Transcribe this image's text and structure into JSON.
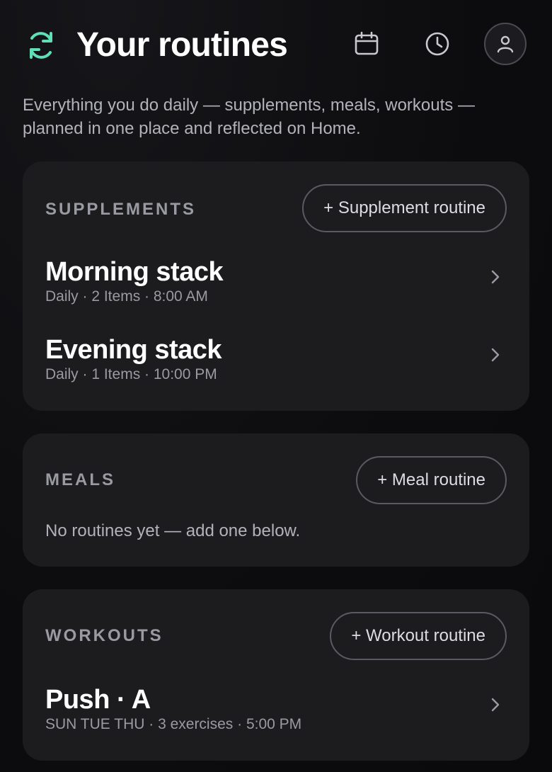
{
  "header": {
    "title": "Your routines",
    "logo_icon": "sync-icon",
    "calendar_icon": "calendar-icon",
    "history_icon": "clock-icon",
    "profile_icon": "user-icon",
    "accent_color": "#5ee0b4"
  },
  "subtitle": "Everything you do daily — supplements, meals, workouts — planned in one place and reflected on Home.",
  "sections": {
    "supplements": {
      "label": "SUPPLEMENTS",
      "add_label": "+ Supplement routine",
      "routines": [
        {
          "title": "Morning stack",
          "meta": "Daily · 2 Items · 8:00 AM"
        },
        {
          "title": "Evening stack",
          "meta": "Daily · 1 Items · 10:00 PM"
        }
      ]
    },
    "meals": {
      "label": "MEALS",
      "add_label": "+ Meal routine",
      "empty_text": "No routines yet — add one below."
    },
    "workouts": {
      "label": "WORKOUTS",
      "add_label": "+ Workout routine",
      "routines": [
        {
          "title": "Push · A",
          "meta": "SUN TUE THU · 3 exercises · 5:00 PM"
        }
      ]
    }
  }
}
